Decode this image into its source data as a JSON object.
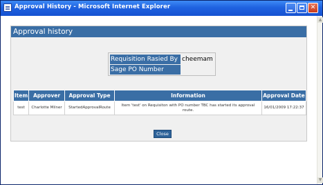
{
  "window": {
    "title": "Approval History - Microsoft Internet Explorer"
  },
  "panel": {
    "heading": "Approval history"
  },
  "requisition": {
    "raised_by_label": "Requisition Rasied By",
    "raised_by_value": "cheemam",
    "sage_po_label": "Sage PO Number",
    "sage_po_value": ""
  },
  "table": {
    "headers": [
      "Item",
      "Approver",
      "Approval Type",
      "Information",
      "Approval Date"
    ],
    "rows": [
      {
        "item": "test",
        "approver": "Charlotte Milner",
        "approval_type": "StartedApprovalRoute",
        "information": "Item 'test' on Requisiton with PO number TBC has started its approval route.",
        "approval_date": "16/01/2009 17:22:37"
      }
    ]
  },
  "buttons": {
    "close_label": "Close"
  },
  "icons": {
    "window_icon": "ie-page-icon",
    "minimize": "minimize-icon",
    "maximize": "maximize-icon",
    "close": "close-icon"
  },
  "colors": {
    "titlebar": "#1f62e0",
    "header_blue": "#3a6ea5",
    "panel_bg": "#f0f0f0",
    "button_bg": "#2d6299"
  }
}
